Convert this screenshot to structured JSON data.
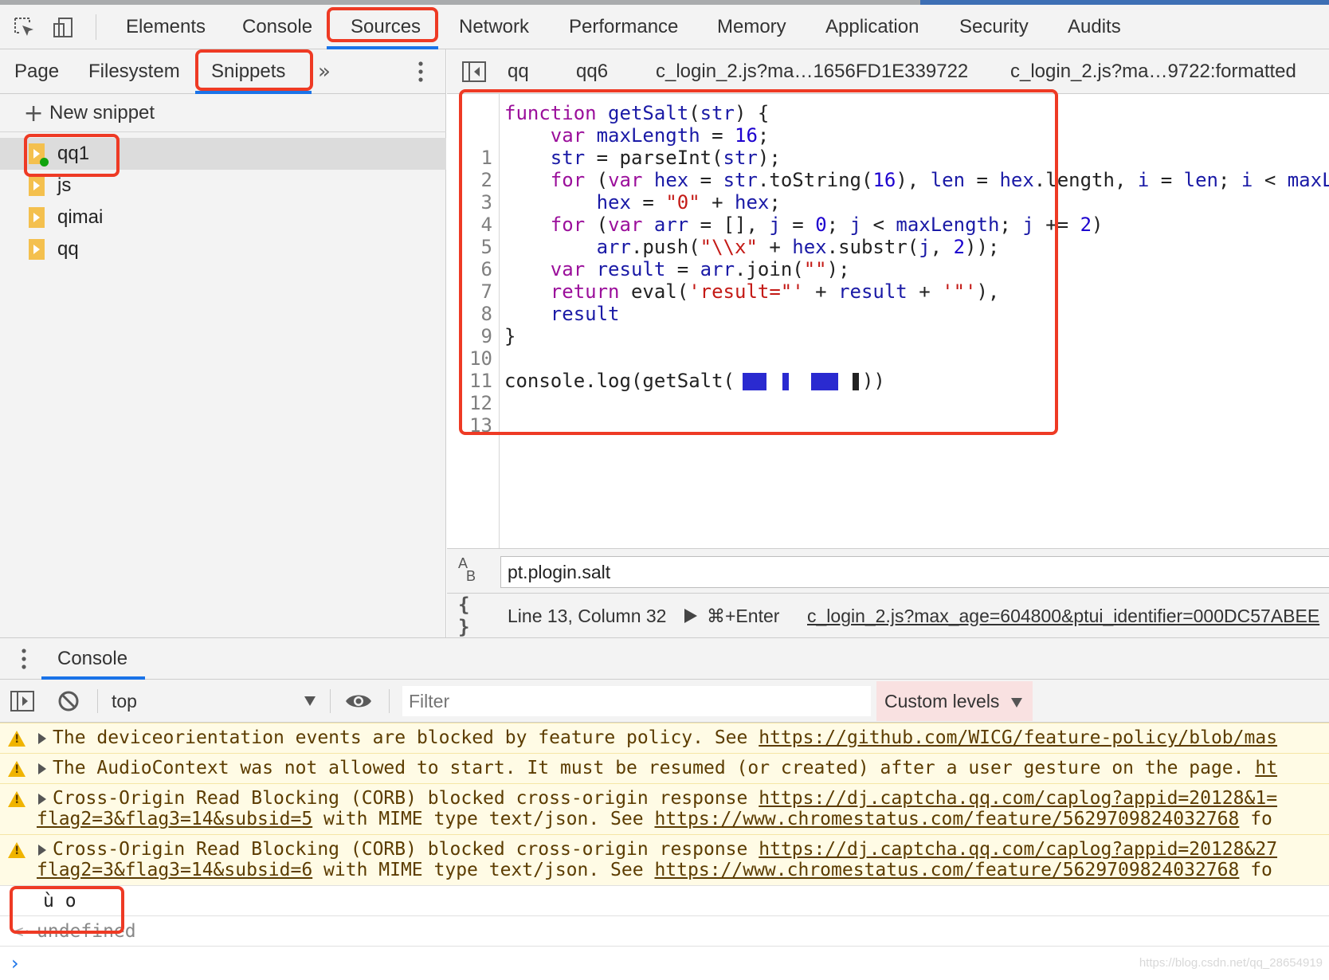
{
  "main_tabs": [
    "Elements",
    "Console",
    "Sources",
    "Network",
    "Performance",
    "Memory",
    "Application",
    "Security",
    "Audits"
  ],
  "navigator": {
    "tabs": [
      "Page",
      "Filesystem",
      "Snippets"
    ],
    "new_snippet": "New snippet",
    "snippets": [
      "qq1",
      "js",
      "qimai",
      "qq"
    ]
  },
  "editor": {
    "tabs": [
      "qq",
      "qq6",
      "c_login_2.js?ma…1656FD1E339722",
      "c_login_2.js?ma…9722:formatted"
    ],
    "line_numbers": [
      "1",
      "2",
      "3",
      "4",
      "5",
      "6",
      "7",
      "8",
      "9",
      "10",
      "11",
      "12",
      "13"
    ],
    "search_value": "pt.plogin.salt",
    "status_position": "Line 13, Column 32",
    "run_shortcut": "⌘+Enter",
    "source_link": "c_login_2.js?max_age=604800&ptui_identifier=000DC57ABEE"
  },
  "console": {
    "drawer_tab": "Console",
    "context": "top",
    "filter_placeholder": "Filter",
    "levels": "Custom levels",
    "messages": [
      {
        "text": "The deviceorientation events are blocked by feature policy. See ",
        "link": "https://github.com/WICG/feature-policy/blob/mas"
      },
      {
        "text": "The AudioContext was not allowed to start. It must be resumed (or created) after a user gesture on the page. ",
        "link": "ht"
      },
      {
        "text": "Cross-Origin Read Blocking (CORB) blocked cross-origin response ",
        "link": "https://dj.captcha.qq.com/caplog?appid=20128&1=",
        "line2_link": "flag2=3&flag3=14&subsid=5",
        "line2_mid": " with MIME type text/json. See ",
        "line2_link2": "https://www.chromestatus.com/feature/5629709824032768",
        "line2_tail": " fo"
      },
      {
        "text": "Cross-Origin Read Blocking (CORB) blocked cross-origin response ",
        "link": "https://dj.captcha.qq.com/caplog?appid=20128&27",
        "line2_link": "flag2=3&flag3=14&subsid=6",
        "line2_mid": " with MIME type text/json. See ",
        "line2_link2": "https://www.chromestatus.com/feature/5629709824032768",
        "line2_tail": " fo"
      }
    ],
    "output": "ù o",
    "return_value": "undefined"
  },
  "watermark": "https://blog.csdn.net/qq_28654919",
  "colors": {
    "highlight_box": "#ee3a24",
    "accent_tab": "#1a73e8",
    "keyword": "#9b0f9b",
    "string": "#c41a16",
    "number": "#1c00cf"
  }
}
